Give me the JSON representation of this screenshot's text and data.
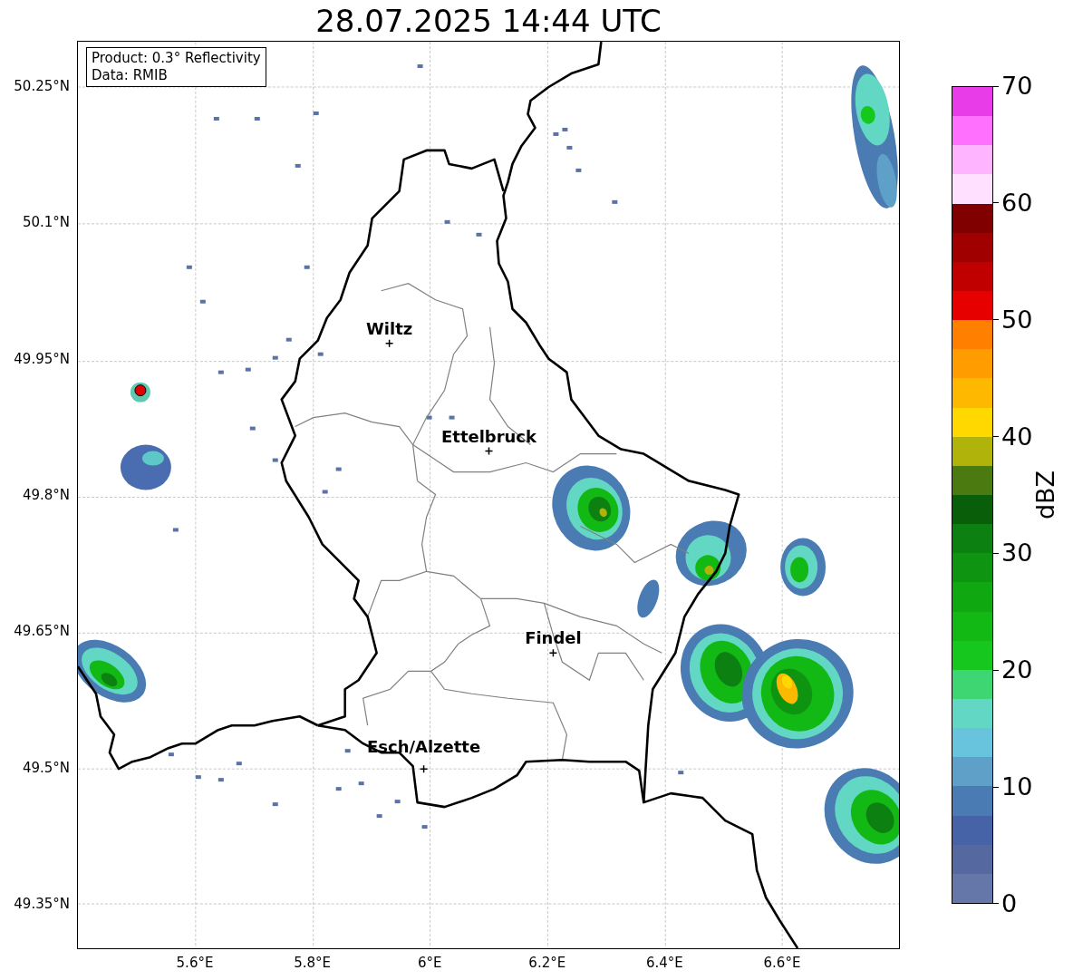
{
  "title": "28.07.2025 14:44 UTC",
  "info_box": {
    "lines": [
      "Product: 0.3° Reflectivity",
      "Data: RMIB"
    ]
  },
  "lat_ticks": [
    "50.25°N",
    "50.1°N",
    "49.95°N",
    "49.8°N",
    "49.65°N",
    "49.5°N",
    "49.35°N"
  ],
  "lon_ticks": [
    "5.6°E",
    "5.8°E",
    "6°E",
    "6.2°E",
    "6.4°E",
    "6.6°E"
  ],
  "places": [
    {
      "name": "Wiltz"
    },
    {
      "name": "Ettelbruck"
    },
    {
      "name": "Findel"
    },
    {
      "name": "Esch/Alzette"
    }
  ],
  "colorbar": {
    "label": "dBZ",
    "ticks": [
      "70",
      "60",
      "50",
      "40",
      "30",
      "20",
      "10",
      "0"
    ],
    "segments": [
      {
        "color": "#e83ce8"
      },
      {
        "color": "#ff70ff"
      },
      {
        "color": "#ffb4ff"
      },
      {
        "color": "#ffe0ff"
      },
      {
        "color": "#800000"
      },
      {
        "color": "#a00000"
      },
      {
        "color": "#c00000"
      },
      {
        "color": "#e60000"
      },
      {
        "color": "#ff7f00"
      },
      {
        "color": "#ff9c00"
      },
      {
        "color": "#ffb800"
      },
      {
        "color": "#ffd800"
      },
      {
        "color": "#b0b40a"
      },
      {
        "color": "#4a7a10"
      },
      {
        "color": "#095e0a"
      },
      {
        "color": "#0c8010"
      },
      {
        "color": "#0e9410"
      },
      {
        "color": "#10a810"
      },
      {
        "color": "#12b814"
      },
      {
        "color": "#16c81e"
      },
      {
        "color": "#3ed672"
      },
      {
        "color": "#62d8c4"
      },
      {
        "color": "#68c4dc"
      },
      {
        "color": "#5ea0c8"
      },
      {
        "color": "#4a7cb3"
      },
      {
        "color": "#4663a7"
      },
      {
        "color": "#55689f"
      },
      {
        "color": "#6577a8"
      }
    ]
  }
}
